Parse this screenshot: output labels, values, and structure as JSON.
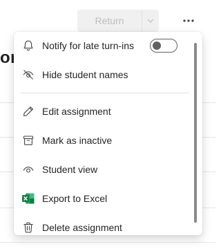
{
  "page": {
    "return_label": "Return",
    "heading_fragment": "ory"
  },
  "menu": {
    "items": [
      {
        "label": "Notify for late turn-ins",
        "icon": "bell-icon"
      },
      {
        "label": "Hide student names",
        "icon": "eye-off-icon"
      },
      {
        "label": "Edit assignment",
        "icon": "pencil-icon"
      },
      {
        "label": "Mark as inactive",
        "icon": "archive-icon"
      },
      {
        "label": "Student view",
        "icon": "eye-icon"
      },
      {
        "label": "Export to Excel",
        "icon": "excel-icon"
      },
      {
        "label": "Delete assignment",
        "icon": "trash-icon"
      }
    ],
    "notify_toggle_on": false
  },
  "colors": {
    "excel_green": "#107c41",
    "icon_gray": "#424242",
    "disabled_text": "#bdbdbd"
  }
}
